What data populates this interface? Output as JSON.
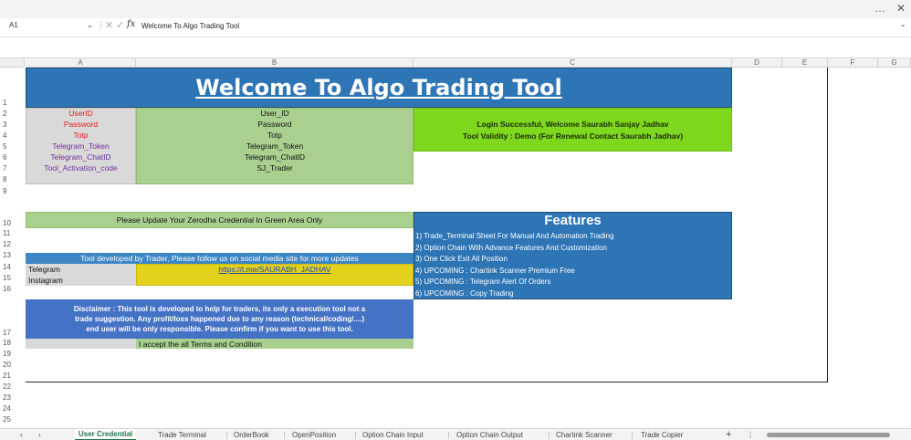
{
  "window": {
    "more_icon": "…",
    "close_icon": "✕"
  },
  "formula_bar": {
    "name_box": "A1",
    "chevron": "⌄",
    "sep": "⋮",
    "cancel": "✕",
    "enter": "✓",
    "fx": "fx",
    "value": "Welcome To Algo Trading Tool",
    "expand": "⌄"
  },
  "columns": [
    "A",
    "B",
    "C",
    "D",
    "E",
    "F",
    "G"
  ],
  "rows": [
    "1",
    "2",
    "3",
    "4",
    "5",
    "6",
    "7",
    "8",
    "9",
    "10",
    "11",
    "12",
    "13",
    "14",
    "15",
    "16",
    "17",
    "18",
    "19",
    "20",
    "21",
    "22",
    "23",
    "24",
    "25"
  ],
  "sheet": {
    "title": "Welcome To Algo Trading Tool",
    "credential_labels": [
      "UserID",
      "Password",
      "Totp",
      "Telegram_Token",
      "Telegram_ChatID",
      "Tool_Activation_code"
    ],
    "credential_values": [
      "User_ID",
      "Password",
      "Totp",
      "Telegram_Token",
      "Telegram_ChatID",
      "SJ_Trader"
    ],
    "login_line1": "Login Successful, Welcome Saurabh Sanjay Jadhav",
    "login_line2": "Tool Validity : Demo (For Renewal Contact Saurabh Jadhav)",
    "update_note": "Please Update Your Zerodha Credential In Green Area Only",
    "features_title": "Features",
    "features": [
      "1) Trade_Terminal Sheet For Manual And Automation Trading",
      "2) Option Chain With Advance Features And Customization",
      "3) One Click Exit All Position",
      "4) UPCOMING : Chartink Scanner Premium Free",
      "5) UPCOMING : Telegram Alert Of Orders",
      "6) UPCOMING : Copy Trading"
    ],
    "follow_note": "Tool developed by Trader, Please follow us on social media site for more updates",
    "telegram_label": "Telegram",
    "telegram_link": "https://t.me/SAURABH_JADHAV",
    "instagram_label": "Instagram",
    "disclaimer_1": "Disclaimer : This tool is developed to help for traders, its only a execution tool not a",
    "disclaimer_2": "trade suggestion. Any profit/loss happened due to any reason (technical/coding/....)",
    "disclaimer_3": "end user will be only responsible. Please confirm if you want to use this tool.",
    "terms": "I accept the all Terms and Condition"
  },
  "tabs": {
    "nav_prev": "‹",
    "nav_next": "›",
    "items": [
      "User Credential",
      "Trade Terminal",
      "OrderBook",
      "OpenPosition",
      "Option Chain Input",
      "Option Chain Output",
      "Chartink Scanner",
      "Trade Copier"
    ],
    "add": "+",
    "more": "⋮"
  },
  "colors": {
    "header_blue": "#2e75b6",
    "red_text": "#e02020",
    "purple_text": "#7030a0",
    "label_grey": "#d9d9d9",
    "value_green": "#a9d08e",
    "login_green": "#7fd81e",
    "link_yellow": "#e3d11c",
    "features_blue": "#2e75b6",
    "follow_blue": "#3d86c6",
    "disclaimer_blue": "#4472c4"
  }
}
